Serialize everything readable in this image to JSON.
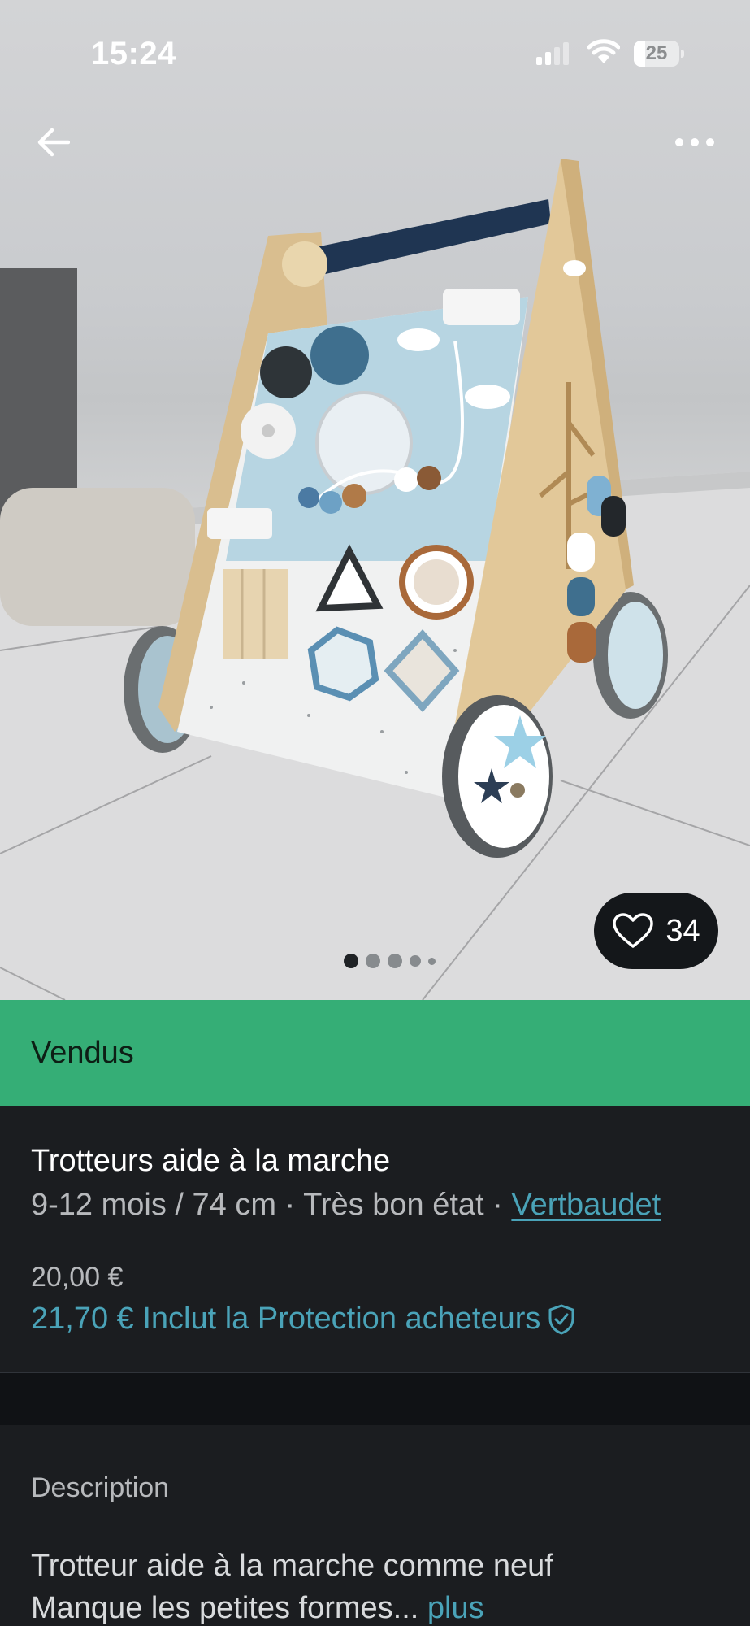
{
  "status_bar": {
    "time": "15:24",
    "battery_level": "25",
    "battery_fraction": 0.25,
    "signal_bars_active": 2
  },
  "nav": {
    "back_icon": "arrow-left-icon",
    "more_icon": "ellipsis-icon"
  },
  "photo": {
    "likes": "34",
    "like_icon": "heart-outline-icon",
    "carousel_total": 5,
    "carousel_active_index": 0
  },
  "banner": {
    "label": "Vendus",
    "color": "#35ae76"
  },
  "item": {
    "title": "Trotteurs aide à la marche",
    "size": "9-12 mois / 74 cm",
    "separator": " · ",
    "condition": "Très bon état",
    "brand": "Vertbaudet",
    "price": "20,00 €",
    "total_price": "21,70 € Inclut la Protection acheteurs",
    "protection_icon": "shield-check-icon",
    "accent_color": "#4aa3b8"
  },
  "description": {
    "heading": "Description",
    "line1": "Trotteur aide à la marche comme neuf",
    "line2": "Manque les petites formes...",
    "more_label": "plus"
  }
}
